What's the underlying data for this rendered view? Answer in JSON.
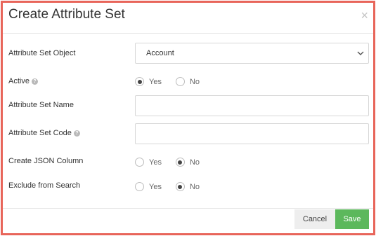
{
  "modal": {
    "title": "Create Attribute Set",
    "close_symbol": "×"
  },
  "form": {
    "object": {
      "label": "Attribute Set Object",
      "value": "Account"
    },
    "active": {
      "label": "Active",
      "help_symbol": "?",
      "options": [
        "Yes",
        "No"
      ],
      "selected": "Yes"
    },
    "name": {
      "label": "Attribute Set Name",
      "value": ""
    },
    "code": {
      "label": "Attribute Set Code",
      "help_symbol": "?",
      "value": ""
    },
    "json_column": {
      "label": "Create JSON Column",
      "options": [
        "Yes",
        "No"
      ],
      "selected": "No"
    },
    "exclude_search": {
      "label": "Exclude from Search",
      "options": [
        "Yes",
        "No"
      ],
      "selected": "No"
    }
  },
  "footer": {
    "cancel_label": "Cancel",
    "save_label": "Save"
  },
  "colors": {
    "frame_border": "#e8655a",
    "save_button": "#5cb85c",
    "cancel_button": "#eeeeee"
  }
}
